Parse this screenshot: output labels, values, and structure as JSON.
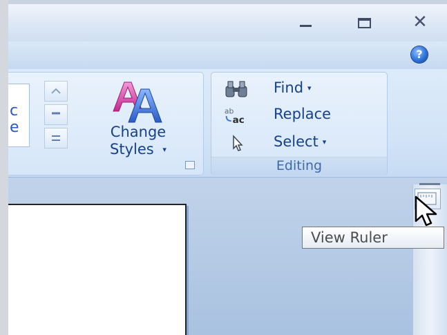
{
  "window": {
    "controls": {
      "minimize": "minimize-icon",
      "maximize": "maximize-icon",
      "close_label": "✕"
    }
  },
  "tabstrip": {
    "help_label": "?"
  },
  "ribbon": {
    "styles_group": {
      "change_styles_line1": "Change",
      "change_styles_line2": "Styles",
      "change_styles_caret": "▾"
    },
    "editing_group": {
      "find_label": "Find",
      "replace_label": "Replace",
      "select_label": "Select",
      "caret": "▾",
      "caption": "Editing"
    }
  },
  "tooltip": {
    "text": "View Ruler"
  },
  "colors": {
    "ribbon_text": "#15428b",
    "caption_text": "#3e6aaa",
    "aa_pink": "#d63ca8",
    "aa_blue": "#3a6fd8"
  },
  "icons": {
    "find": "binoculars-icon",
    "replace": "replace-ab-ac-icon",
    "select": "select-arrow-icon",
    "styles": "change-styles-aa-icon",
    "view_ruler": "view-ruler-icon"
  }
}
